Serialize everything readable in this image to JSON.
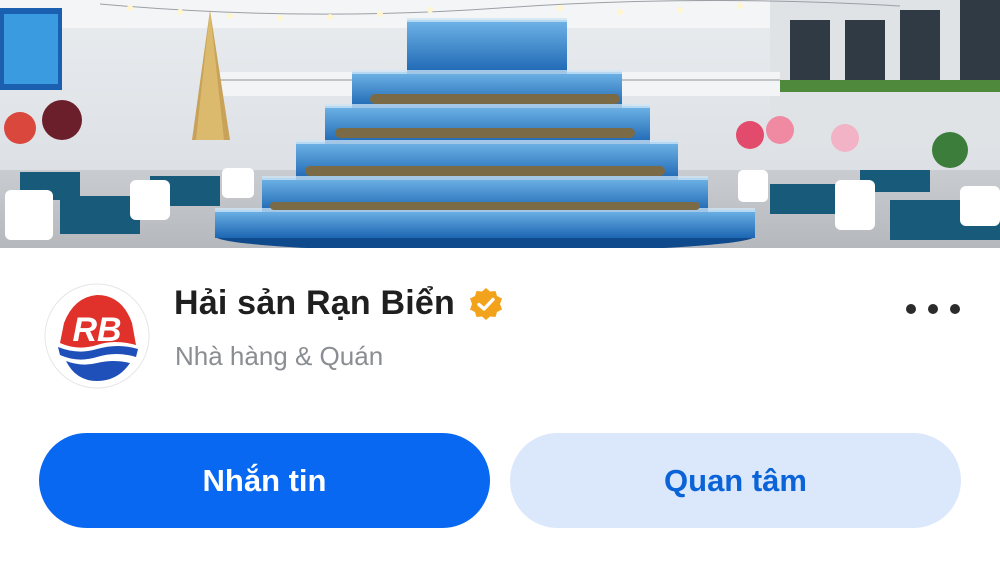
{
  "cover": {
    "description_icon": "restaurant-aquarium-photo"
  },
  "profile": {
    "name": "Hải sản Rạn Biển",
    "category": "Nhà hàng & Quán",
    "verified_icon": "verified-badge-icon",
    "avatar_text": "RB",
    "more_icon": "more-options-icon"
  },
  "actions": {
    "message_label": "Nhắn tin",
    "follow_label": "Quan tâm"
  },
  "colors": {
    "primary": "#0868f1",
    "secondary_bg": "#dbe8fc",
    "secondary_text": "#0b63d8",
    "verified": "#f2a21b",
    "avatar_red": "#e0312a",
    "avatar_blue": "#1f4fb8"
  }
}
